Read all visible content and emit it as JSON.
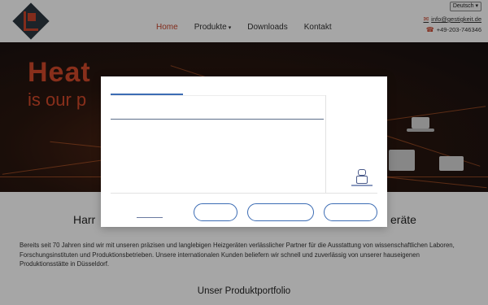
{
  "header": {
    "language": "Deutsch",
    "email": "info@gestigkeit.de",
    "phone": "+49-203-746346",
    "nav": [
      {
        "label": "Home",
        "active": true
      },
      {
        "label": "Produkte",
        "dropdown": true
      },
      {
        "label": "Downloads"
      },
      {
        "label": "Kontakt"
      }
    ]
  },
  "hero": {
    "title_line1": "Heat",
    "title_line2": "is our p"
  },
  "content": {
    "heading_left": "Harr",
    "heading_right": "eräte",
    "intro": "Bereits seit 70 Jahren sind wir mit unseren präzisen und langlebigen Heizgeräten verlässlicher Partner für die Ausstattung von wissenschaftlichen Laboren, Forschungsinstituten und Produktionsbetrieben. Unsere internationalen Kunden beliefern wir schnell und zuverlässig von unserer hauseigenen Produktionsstätte in Düsseldorf.",
    "portfolio_heading": "Unser Produktportfolio"
  },
  "colors": {
    "accent": "#c8442c",
    "modal_accent": "#3c6cb4"
  }
}
